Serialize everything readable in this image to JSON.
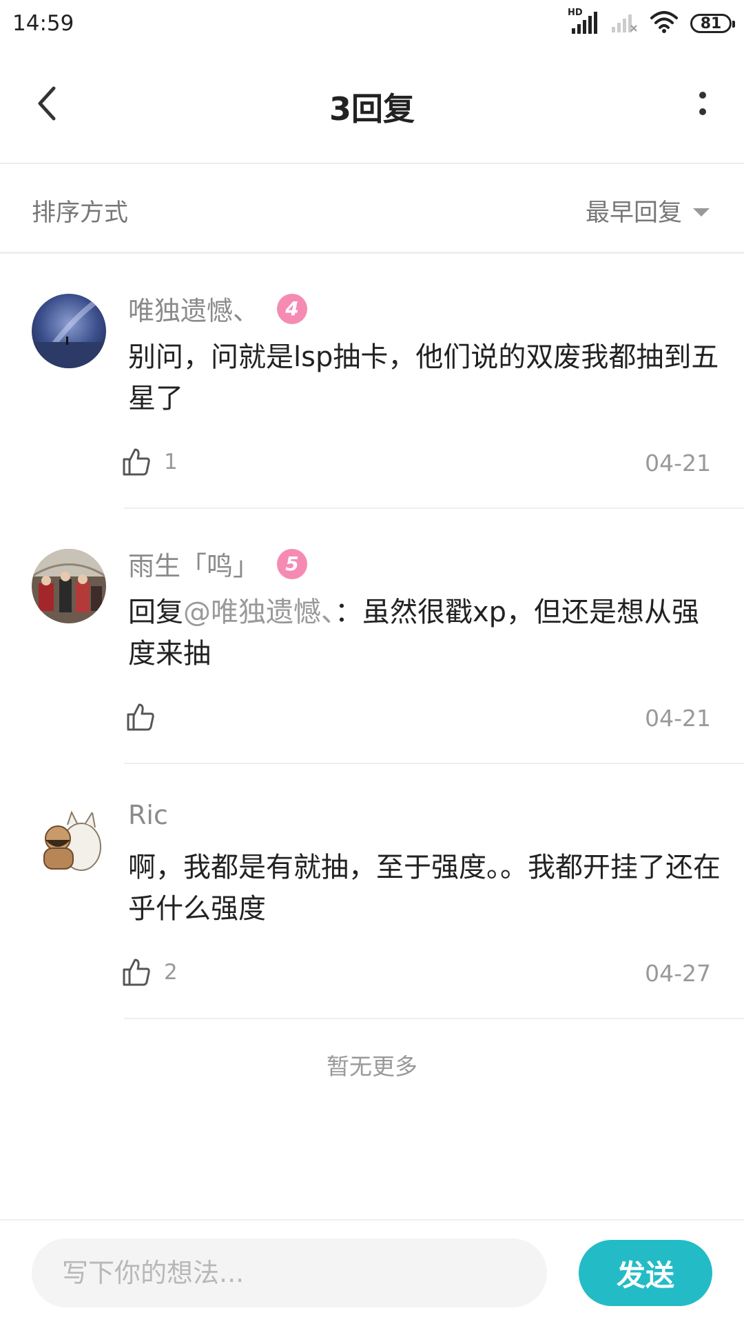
{
  "status_bar": {
    "time": "14:59",
    "signal_label": "HD",
    "battery": "81",
    "icons": [
      "hd-signal-icon",
      "no-signal-icon",
      "wifi-icon",
      "battery-icon"
    ]
  },
  "nav": {
    "title": "3回复",
    "back_icon": "chevron-left-icon",
    "more_icon": "more-vertical-icon"
  },
  "sort": {
    "label": "排序方式",
    "selected": "最早回复"
  },
  "comments": [
    {
      "username": "唯独遗憾、",
      "level": "4",
      "content": "别问，问就是lsp抽卡，他们说的双废我都抽到五星了",
      "likes": "1",
      "date": "04-21"
    },
    {
      "username": "雨生「鸣」",
      "level": "5",
      "reply_prefix": "回复",
      "reply_mention": "@唯独遗憾、",
      "content": "：虽然很戳xp，但还是想从强度来抽",
      "likes": "",
      "date": "04-21"
    },
    {
      "username": "Ric",
      "level": "",
      "content": "啊，我都是有就抽，至于强度。。我都开挂了还在乎什么强度",
      "likes": "2",
      "date": "04-27"
    }
  ],
  "footer_note": "暂无更多",
  "composer": {
    "placeholder": "写下你的想法...",
    "value": "",
    "send_label": "发送"
  },
  "colors": {
    "accent": "#23bcc6",
    "level_badge": "#f58bb3",
    "secondary_text": "#999999"
  }
}
